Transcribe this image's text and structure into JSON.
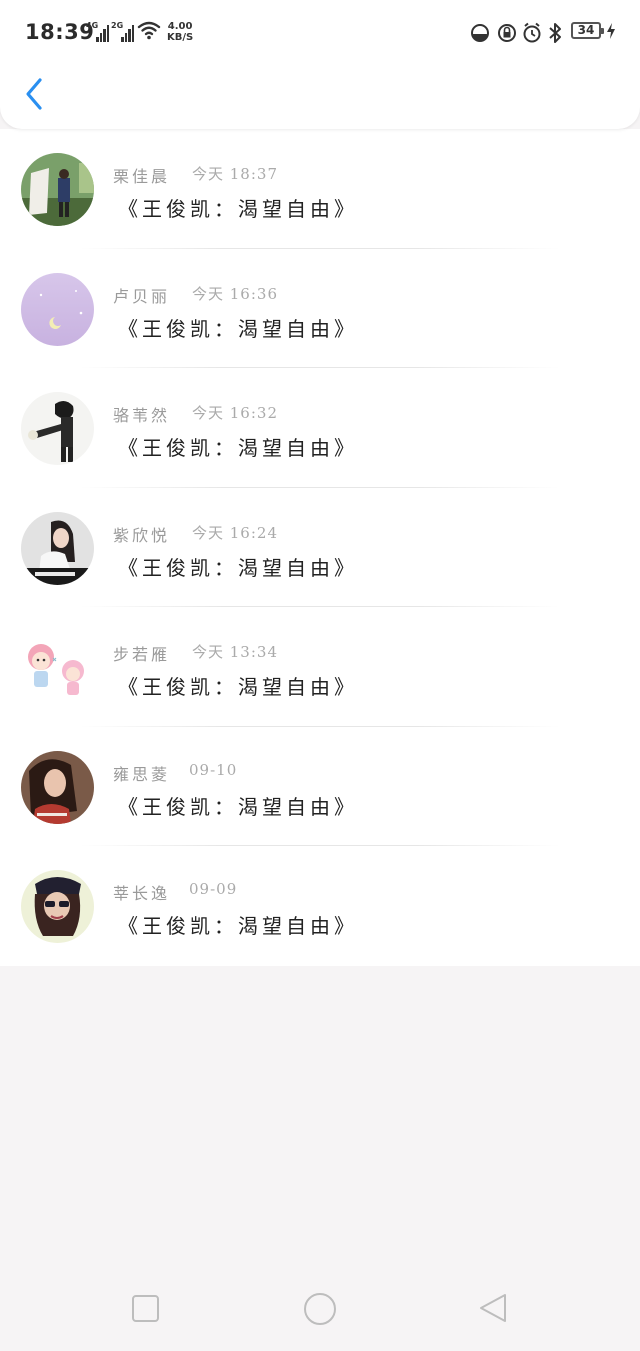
{
  "status_bar": {
    "time": "18:39",
    "network_1": "4G",
    "network_2": "2G",
    "speed_value": "4.00",
    "speed_unit": "KB/S",
    "battery": "34"
  },
  "messages": [
    {
      "name": "栗佳晨",
      "time": "今天 18:37",
      "text": "《王俊凯：渴望自由》",
      "avatar": "avatar-wedding-couple"
    },
    {
      "name": "卢贝丽",
      "time": "今天 16:36",
      "text": "《王俊凯：渴望自由》",
      "avatar": "avatar-purple-moon"
    },
    {
      "name": "骆苇然",
      "time": "今天 16:32",
      "text": "《王俊凯：渴望自由》",
      "avatar": "avatar-anime-boy"
    },
    {
      "name": "紫欣悦",
      "time": "今天 16:24",
      "text": "《王俊凯：渴望自由》",
      "avatar": "avatar-girl-photo"
    },
    {
      "name": "步若雁",
      "time": "今天 13:34",
      "text": "《王俊凯：渴望自由》",
      "avatar": "avatar-cartoon-kids"
    },
    {
      "name": "雍思菱",
      "time": "09-10",
      "text": "《王俊凯：渴望自由》",
      "avatar": "avatar-woman-portrait"
    },
    {
      "name": "莘长逸",
      "time": "09-09",
      "text": "《王俊凯：渴望自由》",
      "avatar": "avatar-girl-cap"
    }
  ],
  "colors": {
    "accent": "#2a8ff0",
    "background": "#f6f4f5",
    "name_text": "#9a9a9a",
    "message_text": "#222222"
  }
}
